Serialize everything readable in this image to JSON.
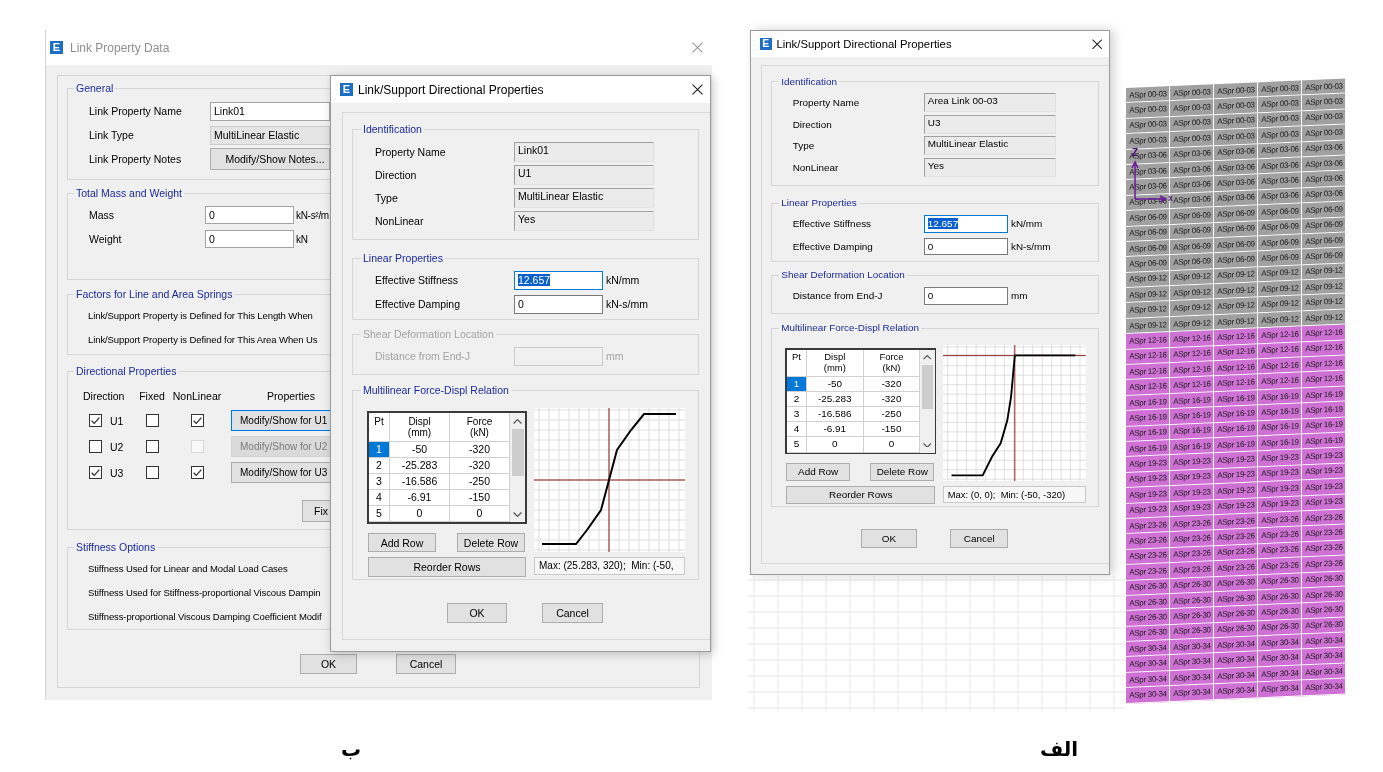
{
  "left_panel": {
    "link_property_dialog": {
      "icon_letter": "E",
      "title": "Link Property Data",
      "general": {
        "title": "General",
        "fields": [
          {
            "kind": "text",
            "label": "Link Property Name",
            "value": "Link01"
          },
          {
            "kind": "readonly",
            "label": "Link Type",
            "value": "MultiLinear Elastic"
          },
          {
            "kind": "button",
            "label": "Link Property Notes",
            "value": "Modify/Show Notes..."
          }
        ]
      },
      "mass_and_weight": {
        "title": "Total Mass and Weight",
        "fields": [
          {
            "label": "Mass",
            "value": "0",
            "unit": "kN-s²/m"
          },
          {
            "label": "Weight",
            "value": "0",
            "unit": "kN"
          }
        ]
      },
      "spring_factors": {
        "title": "Factors for Line and Area Springs",
        "lines": [
          "Link/Support Property is Defined for This Length When",
          "Link/Support Property is Defined for This Area When Us"
        ]
      },
      "directional_properties": {
        "title": "Directional Properties",
        "columns": [
          "Direction",
          "Fixed",
          "NonLinear",
          "Properties"
        ],
        "rows": [
          {
            "direction": "U1",
            "checked": true,
            "fixed": false,
            "nonlinear": true,
            "nonlinear_disabled": false,
            "button": "Modify/Show for U1",
            "button_disabled": false,
            "focused": true
          },
          {
            "direction": "U2",
            "checked": false,
            "fixed": false,
            "nonlinear": false,
            "nonlinear_disabled": true,
            "button": "Modify/Show for U2",
            "button_disabled": true,
            "focused": false
          },
          {
            "direction": "U3",
            "checked": true,
            "fixed": false,
            "nonlinear": true,
            "nonlinear_disabled": false,
            "button": "Modify/Show for U3",
            "button_disabled": false,
            "focused": false
          }
        ],
        "fix_button": "Fix"
      },
      "stiffness_options": {
        "title": "Stiffness Options",
        "lines": [
          "Stiffness Used for Linear and Modal Load Cases",
          "Stiffness Used for Stiffness-proportional Viscous Dampin",
          "Stiffness-proportional Viscous Damping Coefficient Modif"
        ]
      },
      "buttons": [
        "OK",
        "Cancel"
      ]
    },
    "directional_dialog": {
      "icon_letter": "E",
      "title": "Link/Support Directional Properties",
      "identification": {
        "title": "Identification",
        "fields": [
          {
            "label": "Property Name",
            "value": "Link01"
          },
          {
            "label": "Direction",
            "value": "U1"
          },
          {
            "label": "Type",
            "value": "MultiLinear Elastic"
          },
          {
            "label": "NonLinear",
            "value": "Yes"
          }
        ]
      },
      "linear_properties": {
        "title": "Linear Properties",
        "fields": [
          {
            "label": "Effective Stiffness",
            "value": "12.657",
            "unit": "kN/mm",
            "text_selected": true,
            "focused": true
          },
          {
            "label": "Effective Damping",
            "value": "0",
            "unit": "kN-s/mm",
            "text_selected": false,
            "focused": false
          }
        ]
      },
      "shear_deformation": {
        "title": "Shear Deformation Location",
        "disabled": true,
        "label": "Distance from End-J",
        "unit": "mm"
      },
      "force_displ_relation": {
        "title": "Multilinear Force-Displ Relation",
        "columns": [
          {
            "name": "Pt"
          },
          {
            "name": "Displ",
            "unit": "(mm)"
          },
          {
            "name": "Force",
            "unit": "(kN)"
          }
        ],
        "rows": [
          {
            "cells": [
              "1",
              "-50",
              "-320"
            ],
            "selected": true
          },
          {
            "cells": [
              "2",
              "-25.283",
              "-320"
            ],
            "selected": false
          },
          {
            "cells": [
              "3",
              "-16.586",
              "-250"
            ],
            "selected": false
          },
          {
            "cells": [
              "4",
              "-6.91",
              "-150"
            ],
            "selected": false
          },
          {
            "cells": [
              "5",
              "0",
              "0"
            ],
            "selected": false
          }
        ],
        "row_buttons": [
          "Add Row",
          "Delete Row"
        ],
        "reorder_button": "Reorder Rows",
        "plot_range": "Max: (25.283, 320);  Min: (-50,"
      },
      "buttons": [
        "OK",
        "Cancel"
      ]
    },
    "caption": "ب"
  },
  "right_panel": {
    "directional_dialog": {
      "icon_letter": "E",
      "title": "Link/Support Directional Properties",
      "identification": {
        "title": "Identification",
        "fields": [
          {
            "label": "Property Name",
            "value": "Area Link 00-03"
          },
          {
            "label": "Direction",
            "value": "U3"
          },
          {
            "label": "Type",
            "value": "MultiLinear Elastic"
          },
          {
            "label": "NonLinear",
            "value": "Yes"
          }
        ]
      },
      "linear_properties": {
        "title": "Linear Properties",
        "fields": [
          {
            "label": "Effective Stiffness",
            "value": "12.657",
            "unit": "kN/mm",
            "text_selected": true,
            "focused": true
          },
          {
            "label": "Effective Damping",
            "value": "0",
            "unit": "kN-s/mm",
            "text_selected": false,
            "focused": false
          }
        ]
      },
      "shear_deformation": {
        "title": "Shear Deformation Location",
        "disabled": false,
        "label": "Distance from End-J",
        "value": "0",
        "unit": "mm"
      },
      "force_displ_relation": {
        "title": "Multilinear Force-Displ Relation",
        "columns": [
          {
            "name": "Pt"
          },
          {
            "name": "Displ",
            "unit": "(mm)"
          },
          {
            "name": "Force",
            "unit": "(kN)"
          }
        ],
        "rows": [
          {
            "cells": [
              "1",
              "-50",
              "-320"
            ],
            "selected": true
          },
          {
            "cells": [
              "2",
              "-25.283",
              "-320"
            ],
            "selected": false
          },
          {
            "cells": [
              "3",
              "-16.586",
              "-250"
            ],
            "selected": false
          },
          {
            "cells": [
              "4",
              "-6.91",
              "-150"
            ],
            "selected": false
          },
          {
            "cells": [
              "5",
              "0",
              "0"
            ],
            "selected": false
          }
        ],
        "row_buttons": [
          "Add Row",
          "Delete Row"
        ],
        "reorder_button": "Reorder Rows",
        "plot_range": "Max: (0, 0);  Min: (-50, -320)"
      },
      "buttons": [
        "OK",
        "Cancel"
      ]
    },
    "model_view": {
      "axis_labels": [
        "Z",
        "X"
      ],
      "mesh_rows": [
        {
          "color": "#a0a0a0",
          "labels": [
            "ASpr 00-03",
            "ASpr 00-03",
            "ASpr 00-03",
            "ASpr 00-03",
            "ASpr 00-03"
          ]
        },
        {
          "color": "#a0a0a0",
          "labels": [
            "ASpr 00-03",
            "ASpr 00-03",
            "ASpr 00-03",
            "ASpr 00-03",
            "ASpr 00-03"
          ]
        },
        {
          "color": "#a0a0a0",
          "labels": [
            "ASpr 00-03",
            "ASpr 00-03",
            "ASpr 00-03",
            "ASpr 00-03",
            "ASpr 00-03"
          ]
        },
        {
          "color": "#a0a0a0",
          "labels": [
            "ASpr 00-03",
            "ASpr 00-03",
            "ASpr 00-03",
            "ASpr 00-03",
            "ASpr 00-03"
          ]
        },
        {
          "color": "#a0a0a0",
          "labels": [
            "ASpr 03-06",
            "ASpr 03-06",
            "ASpr 03-06",
            "ASpr 03-06",
            "ASpr 03-06"
          ]
        },
        {
          "color": "#a0a0a0",
          "labels": [
            "ASpr 03-06",
            "ASpr 03-06",
            "ASpr 03-06",
            "ASpr 03-06",
            "ASpr 03-06"
          ]
        },
        {
          "color": "#a0a0a0",
          "labels": [
            "ASpr 03-06",
            "ASpr 03-06",
            "ASpr 03-06",
            "ASpr 03-06",
            "ASpr 03-06"
          ]
        },
        {
          "color": "#a0a0a0",
          "labels": [
            "ASpr 03-06",
            "ASpr 03-06",
            "ASpr 03-06",
            "ASpr 03-06",
            "ASpr 03-06"
          ]
        },
        {
          "color": "#a0a0a0",
          "labels": [
            "ASpr 06-09",
            "ASpr 06-09",
            "ASpr 06-09",
            "ASpr 06-09",
            "ASpr 06-09"
          ]
        },
        {
          "color": "#a0a0a0",
          "labels": [
            "ASpr 06-09",
            "ASpr 06-09",
            "ASpr 06-09",
            "ASpr 06-09",
            "ASpr 06-09"
          ]
        },
        {
          "color": "#a0a0a0",
          "labels": [
            "ASpr 06-09",
            "ASpr 06-09",
            "ASpr 06-09",
            "ASpr 06-09",
            "ASpr 06-09"
          ]
        },
        {
          "color": "#a0a0a0",
          "labels": [
            "ASpr 06-09",
            "ASpr 06-09",
            "ASpr 06-09",
            "ASpr 06-09",
            "ASpr 06-09"
          ]
        },
        {
          "color": "#a0a0a0",
          "labels": [
            "ASpr 09-12",
            "ASpr 09-12",
            "ASpr 09-12",
            "ASpr 09-12",
            "ASpr 09-12"
          ]
        },
        {
          "color": "#a0a0a0",
          "labels": [
            "ASpr 09-12",
            "ASpr 09-12",
            "ASpr 09-12",
            "ASpr 09-12",
            "ASpr 09-12"
          ]
        },
        {
          "color": "#a0a0a0",
          "labels": [
            "ASpr 09-12",
            "ASpr 09-12",
            "ASpr 09-12",
            "ASpr 09-12",
            "ASpr 09-12"
          ]
        },
        {
          "color": "#a0a0a0",
          "labels": [
            "ASpr 09-12",
            "ASpr 09-12",
            "ASpr 09-12",
            "ASpr 09-12",
            "ASpr 09-12"
          ]
        },
        {
          "color": "#cf70d4",
          "labels": [
            "ASpr 12-16",
            "ASpr 12-16",
            "ASpr 12-16",
            "ASpr 12-16",
            "ASpr 12-16"
          ]
        },
        {
          "color": "#cf70d4",
          "labels": [
            "ASpr 12-16",
            "ASpr 12-16",
            "ASpr 12-16",
            "ASpr 12-16",
            "ASpr 12-16"
          ]
        },
        {
          "color": "#cf70d4",
          "labels": [
            "ASpr 12-16",
            "ASpr 12-16",
            "ASpr 12-16",
            "ASpr 12-16",
            "ASpr 12-16"
          ]
        },
        {
          "color": "#cf70d4",
          "labels": [
            "ASpr 12-16",
            "ASpr 12-16",
            "ASpr 12-16",
            "ASpr 12-16",
            "ASpr 12-16"
          ]
        },
        {
          "color": "#cf70d4",
          "labels": [
            "ASpr 16-19",
            "ASpr 16-19",
            "ASpr 16-19",
            "ASpr 16-19",
            "ASpr 16-19"
          ]
        },
        {
          "color": "#cf70d4",
          "labels": [
            "ASpr 16-19",
            "ASpr 16-19",
            "ASpr 16-19",
            "ASpr 16-19",
            "ASpr 16-19"
          ]
        },
        {
          "color": "#cf70d4",
          "labels": [
            "ASpr 16-19",
            "ASpr 16-19",
            "ASpr 16-19",
            "ASpr 16-19",
            "ASpr 16-19"
          ]
        },
        {
          "color": "#cf70d4",
          "labels": [
            "ASpr 16-19",
            "ASpr 16-19",
            "ASpr 16-19",
            "ASpr 16-19",
            "ASpr 16-19"
          ]
        },
        {
          "color": "#cf70d4",
          "labels": [
            "ASpr 19-23",
            "ASpr 19-23",
            "ASpr 19-23",
            "ASpr 19-23",
            "ASpr 19-23"
          ]
        },
        {
          "color": "#cf70d4",
          "labels": [
            "ASpr 19-23",
            "ASpr 19-23",
            "ASpr 19-23",
            "ASpr 19-23",
            "ASpr 19-23"
          ]
        },
        {
          "color": "#cf70d4",
          "labels": [
            "ASpr 19-23",
            "ASpr 19-23",
            "ASpr 19-23",
            "ASpr 19-23",
            "ASpr 19-23"
          ]
        },
        {
          "color": "#cf70d4",
          "labels": [
            "ASpr 19-23",
            "ASpr 19-23",
            "ASpr 19-23",
            "ASpr 19-23",
            "ASpr 19-23"
          ]
        },
        {
          "color": "#cf70d4",
          "labels": [
            "ASpr 23-26",
            "ASpr 23-26",
            "ASpr 23-26",
            "ASpr 23-26",
            "ASpr 23-26"
          ]
        },
        {
          "color": "#cf70d4",
          "labels": [
            "ASpr 23-26",
            "ASpr 23-26",
            "ASpr 23-26",
            "ASpr 23-26",
            "ASpr 23-26"
          ]
        },
        {
          "color": "#cf70d4",
          "labels": [
            "ASpr 23-26",
            "ASpr 23-26",
            "ASpr 23-26",
            "ASpr 23-26",
            "ASpr 23-26"
          ]
        },
        {
          "color": "#cf70d4",
          "labels": [
            "ASpr 23-26",
            "ASpr 23-26",
            "ASpr 23-26",
            "ASpr 23-26",
            "ASpr 23-26"
          ]
        },
        {
          "color": "#cf70d4",
          "labels": [
            "ASpr 26-30",
            "ASpr 26-30",
            "ASpr 26-30",
            "ASpr 26-30",
            "ASpr 26-30"
          ]
        },
        {
          "color": "#cf70d4",
          "labels": [
            "ASpr 26-30",
            "ASpr 26-30",
            "ASpr 26-30",
            "ASpr 26-30",
            "ASpr 26-30"
          ]
        },
        {
          "color": "#cf70d4",
          "labels": [
            "ASpr 26-30",
            "ASpr 26-30",
            "ASpr 26-30",
            "ASpr 26-30",
            "ASpr 26-30"
          ]
        },
        {
          "color": "#cf70d4",
          "labels": [
            "ASpr 26-30",
            "ASpr 26-30",
            "ASpr 26-30",
            "ASpr 26-30",
            "ASpr 26-30"
          ]
        },
        {
          "color": "#cf70d4",
          "labels": [
            "ASpr 30-34",
            "ASpr 30-34",
            "ASpr 30-34",
            "ASpr 30-34",
            "ASpr 30-34"
          ]
        },
        {
          "color": "#cf70d4",
          "labels": [
            "ASpr 30-34",
            "ASpr 30-34",
            "ASpr 30-34",
            "ASpr 30-34",
            "ASpr 30-34"
          ]
        },
        {
          "color": "#cf70d4",
          "labels": [
            "ASpr 30-34",
            "ASpr 30-34",
            "ASpr 30-34",
            "ASpr 30-34",
            "ASpr 30-34"
          ]
        },
        {
          "color": "#cf70d4",
          "labels": [
            "ASpr 30-34",
            "ASpr 30-34",
            "ASpr 30-34",
            "ASpr 30-34",
            "ASpr 30-34"
          ]
        }
      ]
    },
    "caption": "الف"
  }
}
